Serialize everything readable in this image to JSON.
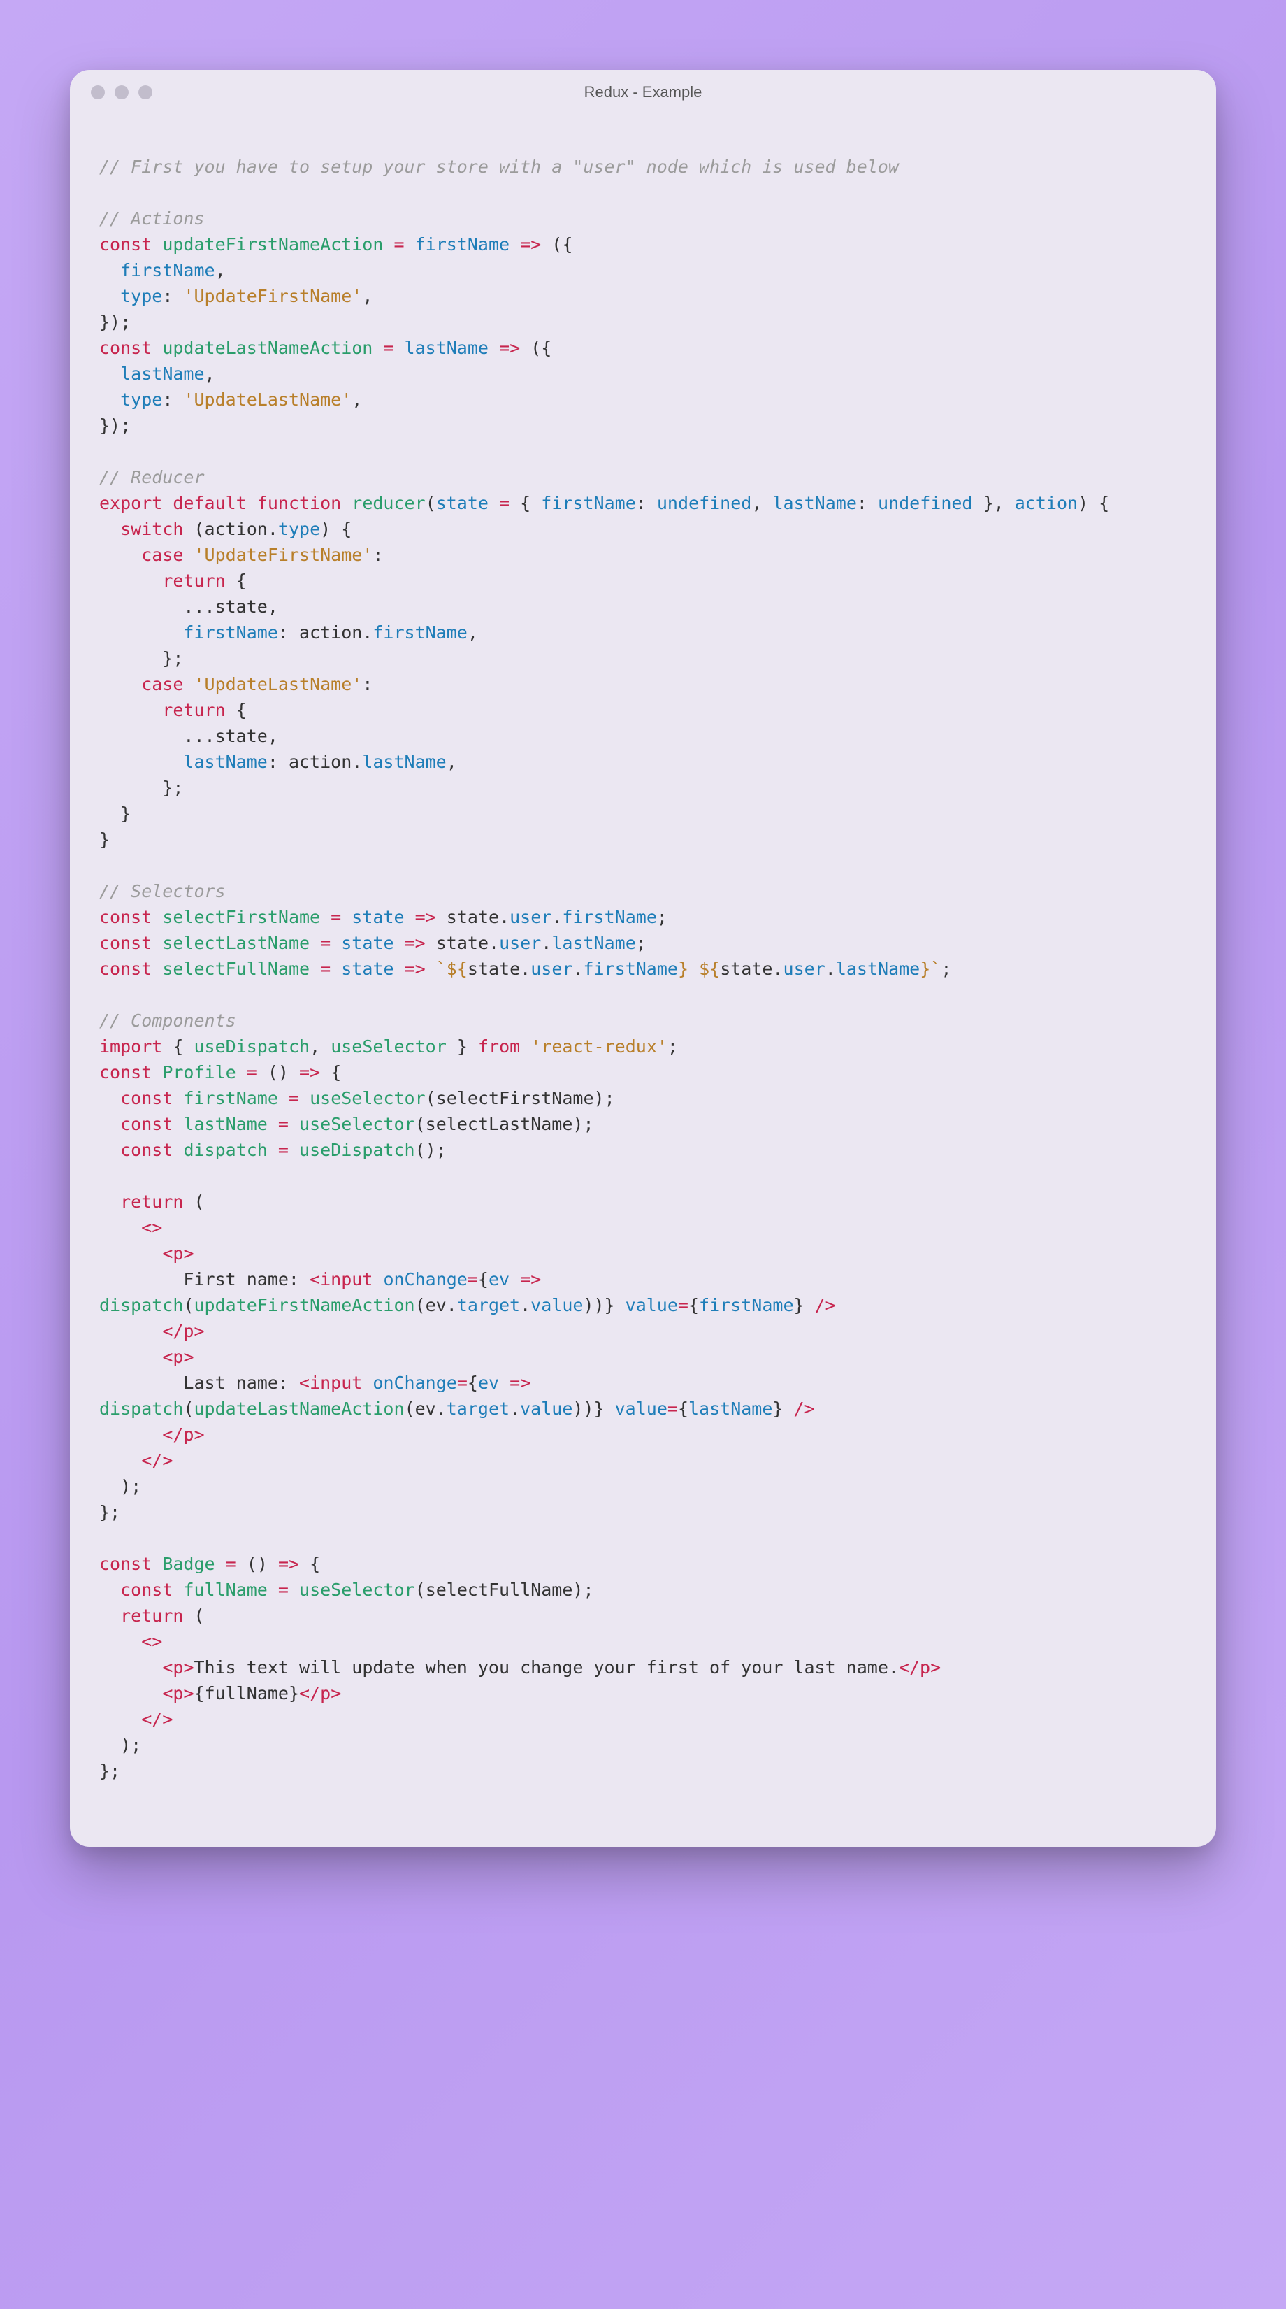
{
  "window": {
    "title": "Redux - Example"
  },
  "code": {
    "l1": "// First you have to setup your store with a \"user\" node which is used below",
    "l3": "// Actions",
    "l4a": "const",
    "l4b": "updateFirstNameAction",
    "l4c": "=",
    "l4d": "firstName",
    "l4e": "=>",
    "l4f": "({",
    "l5a": "firstName",
    "l5b": ",",
    "l6a": "type",
    "l6b": ":",
    "l6c": "'UpdateFirstName'",
    "l6d": ",",
    "l7": "});",
    "l8a": "const",
    "l8b": "updateLastNameAction",
    "l8c": "=",
    "l8d": "lastName",
    "l8e": "=>",
    "l8f": "({",
    "l9a": "lastName",
    "l9b": ",",
    "l10a": "type",
    "l10b": ":",
    "l10c": "'UpdateLastName'",
    "l10d": ",",
    "l11": "});",
    "l13": "// Reducer",
    "l14a": "export",
    "l14b": "default",
    "l14c": "function",
    "l14d": "reducer",
    "l14e": "(",
    "l14f": "state",
    "l14g": "=",
    "l14h": "{",
    "l14i": "firstName",
    "l14j": ":",
    "l14k": "undefined",
    "l14l": ",",
    "l14m": "lastName",
    "l14n": ":",
    "l14o": "undefined",
    "l14p": "}",
    "l14q": ",",
    "l14r": "action",
    "l14s": ") {",
    "l15a": "switch",
    "l15b": "(",
    "l15c": "action",
    "l15d": ".",
    "l15e": "type",
    "l15f": ") {",
    "l16a": "case",
    "l16b": "'UpdateFirstName'",
    "l16c": ":",
    "l17a": "return",
    "l17b": "{",
    "l18a": "...state,",
    "l19a": "firstName",
    "l19b": ": action.",
    "l19c": "firstName",
    "l19d": ",",
    "l20": "};",
    "l21a": "case",
    "l21b": "'UpdateLastName'",
    "l21c": ":",
    "l22a": "return",
    "l22b": "{",
    "l23a": "...state,",
    "l24a": "lastName",
    "l24b": ": action.",
    "l24c": "lastName",
    "l24d": ",",
    "l25": "};",
    "l26": "}",
    "l27": "}",
    "l29": "// Selectors",
    "l30a": "const",
    "l30b": "selectFirstName",
    "l30c": "=",
    "l30d": "state",
    "l30e": "=>",
    "l30f": "state",
    "l30g": ".",
    "l30h": "user",
    "l30i": ".",
    "l30j": "firstName",
    "l30k": ";",
    "l31a": "const",
    "l31b": "selectLastName",
    "l31c": "=",
    "l31d": "state",
    "l31e": "=>",
    "l31f": "state",
    "l31g": ".",
    "l31h": "user",
    "l31i": ".",
    "l31j": "lastName",
    "l31k": ";",
    "l32a": "const",
    "l32b": "selectFullName",
    "l32c": "=",
    "l32d": "state",
    "l32e": "=>",
    "l32f": "`${",
    "l32g": "state",
    "l32h": ".",
    "l32i": "user",
    "l32j": ".",
    "l32k": "firstName",
    "l32l": "}",
    "l32m": " ",
    "l32n": "${",
    "l32o": "state",
    "l32p": ".",
    "l32q": "user",
    "l32r": ".",
    "l32s": "lastName",
    "l32t": "}`",
    "l32u": ";",
    "l34": "// Components",
    "l35a": "import",
    "l35b": "{",
    "l35c": "useDispatch",
    "l35d": ",",
    "l35e": "useSelector",
    "l35f": "}",
    "l35g": "from",
    "l35h": "'react-redux'",
    "l35i": ";",
    "l36a": "const",
    "l36b": "Profile",
    "l36c": "=",
    "l36d": "()",
    "l36e": "=>",
    "l36f": "{",
    "l37a": "const",
    "l37b": "firstName",
    "l37c": "=",
    "l37d": "useSelector",
    "l37e": "(",
    "l37f": "selectFirstName",
    "l37g": ");",
    "l38a": "const",
    "l38b": "lastName",
    "l38c": "=",
    "l38d": "useSelector",
    "l38e": "(",
    "l38f": "selectLastName",
    "l38g": ");",
    "l39a": "const",
    "l39b": "dispatch",
    "l39c": "=",
    "l39d": "useDispatch",
    "l39e": "();",
    "l41a": "return",
    "l41b": "(",
    "l42": "<>",
    "l43a": "<",
    "l43b": "p",
    "l43c": ">",
    "l44a": "First name: ",
    "l44b": "<",
    "l44c": "input",
    "l44d": " ",
    "l44e": "onChange",
    "l44f": "=",
    "l44g": "{",
    "l44h": "ev",
    "l44i": " ",
    "l44j": "=>",
    "l45a": "dispatch",
    "l45b": "(",
    "l45c": "updateFirstNameAction",
    "l45d": "(",
    "l45e": "ev",
    "l45f": ".",
    "l45g": "target",
    "l45h": ".",
    "l45i": "value",
    "l45j": "))}",
    "l45k": " ",
    "l45l": "value",
    "l45m": "=",
    "l45n": "{",
    "l45o": "firstName",
    "l45p": "}",
    "l45q": " />",
    "l46a": "</",
    "l46b": "p",
    "l46c": ">",
    "l47a": "<",
    "l47b": "p",
    "l47c": ">",
    "l48a": "Last name: ",
    "l48b": "<",
    "l48c": "input",
    "l48d": " ",
    "l48e": "onChange",
    "l48f": "=",
    "l48g": "{",
    "l48h": "ev",
    "l48i": " ",
    "l48j": "=>",
    "l49a": "dispatch",
    "l49b": "(",
    "l49c": "updateLastNameAction",
    "l49d": "(",
    "l49e": "ev",
    "l49f": ".",
    "l49g": "target",
    "l49h": ".",
    "l49i": "value",
    "l49j": "))}",
    "l49k": " ",
    "l49l": "value",
    "l49m": "=",
    "l49n": "{",
    "l49o": "lastName",
    "l49p": "}",
    "l49q": " />",
    "l50a": "</",
    "l50b": "p",
    "l50c": ">",
    "l51": "</>",
    "l52": ");",
    "l53": "};",
    "l55a": "const",
    "l55b": "Badge",
    "l55c": "=",
    "l55d": "()",
    "l55e": "=>",
    "l55f": "{",
    "l56a": "const",
    "l56b": "fullName",
    "l56c": "=",
    "l56d": "useSelector",
    "l56e": "(",
    "l56f": "selectFullName",
    "l56g": ");",
    "l57a": "return",
    "l57b": "(",
    "l58": "<>",
    "l59a": "<",
    "l59b": "p",
    "l59c": ">",
    "l59d": "This text will update when you change your first of your last name.",
    "l59e": "</",
    "l59f": "p",
    "l59g": ">",
    "l60a": "<",
    "l60b": "p",
    "l60c": ">",
    "l60d": "{",
    "l60e": "fullName",
    "l60f": "}",
    "l60g": "</",
    "l60h": "p",
    "l60i": ">",
    "l61": "</>",
    "l62": ");",
    "l63": "};"
  }
}
